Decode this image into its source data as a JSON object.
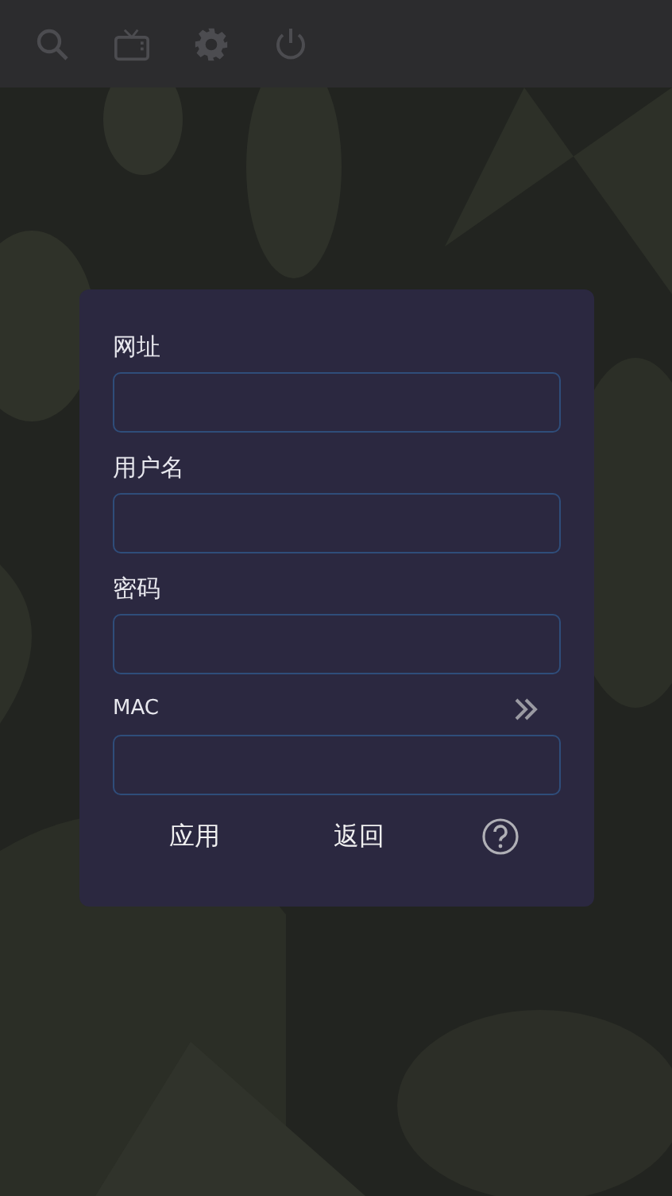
{
  "dialog": {
    "fields": [
      {
        "label": "网址",
        "kind": "plain"
      },
      {
        "label": "用户名",
        "kind": "plain"
      },
      {
        "label": "密码",
        "kind": "plain"
      },
      {
        "label": "MAC",
        "kind": "more"
      }
    ],
    "buttons": [
      "应用",
      "返回"
    ]
  }
}
